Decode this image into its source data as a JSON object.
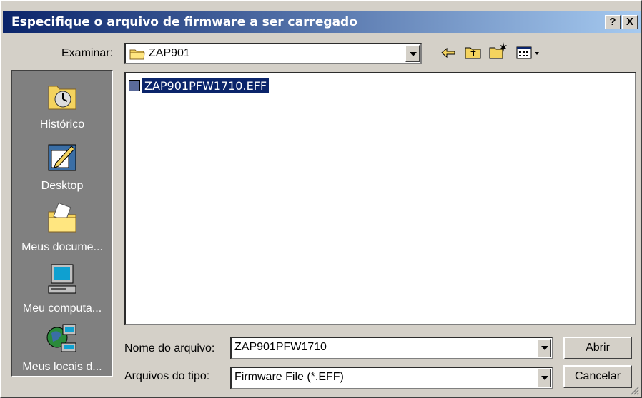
{
  "window": {
    "title": "Especifique o arquivo de firmware a ser carregado",
    "help_label": "?",
    "close_label": "X"
  },
  "lookin": {
    "label": "Examinar:",
    "value": "ZAP901"
  },
  "places": [
    {
      "label": "Histórico",
      "icon": "history-icon"
    },
    {
      "label": "Desktop",
      "icon": "desktop-icon"
    },
    {
      "label": "Meus docume...",
      "icon": "documents-folder-icon"
    },
    {
      "label": "Meu computa...",
      "icon": "computer-icon"
    },
    {
      "label": "Meus locais d...",
      "icon": "network-places-icon"
    }
  ],
  "files": [
    {
      "name": "ZAP901PFW1710.EFF",
      "selected": true
    }
  ],
  "filename": {
    "label": "Nome do arquivo:",
    "value": "ZAP901PFW1710"
  },
  "filetype": {
    "label": "Arquivos do tipo:",
    "value": "Firmware File (*.EFF)"
  },
  "buttons": {
    "open": "Abrir",
    "cancel": "Cancelar"
  },
  "colors": {
    "titlebar_start": "#0a246a",
    "titlebar_end": "#a6caf0",
    "selection": "#0a246a",
    "face": "#d4d0c8"
  }
}
